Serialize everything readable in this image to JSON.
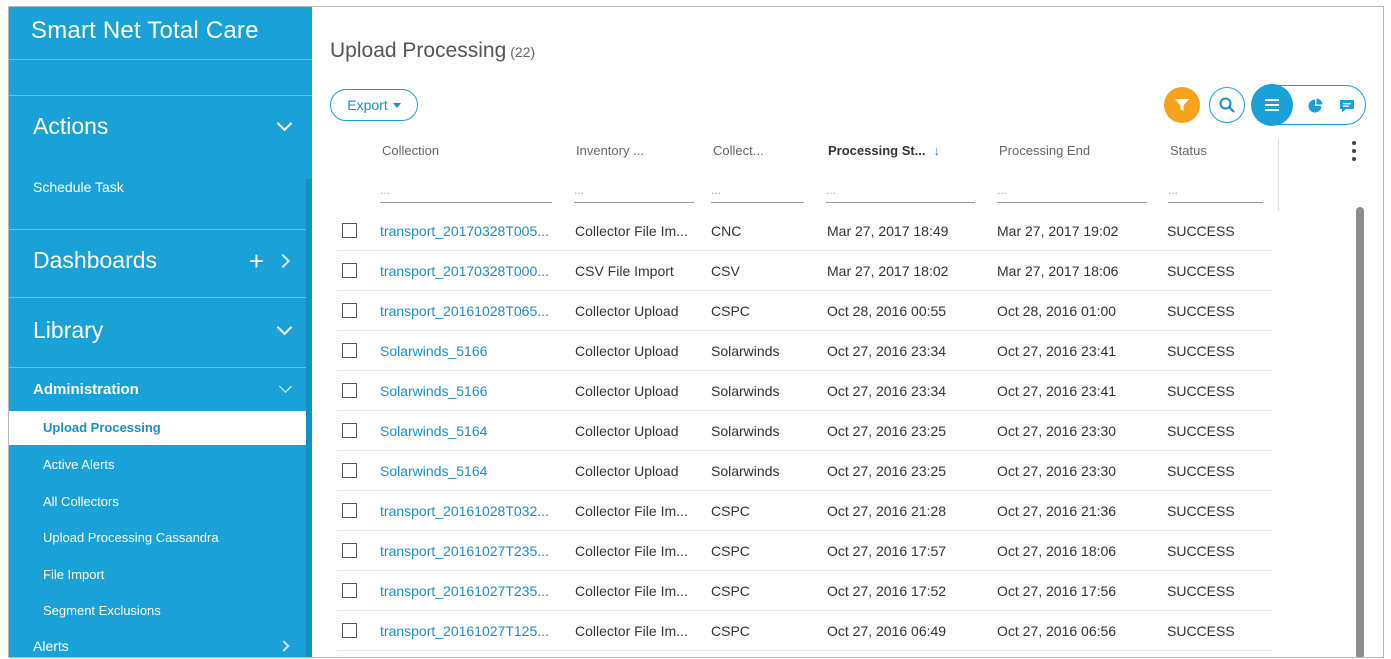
{
  "sidebar": {
    "brand": "Smart Net Total Care",
    "actions": "Actions",
    "schedule_task": "Schedule Task",
    "dashboards": "Dashboards",
    "library": "Library",
    "administration": "Administration",
    "admin_items": [
      "Upload Processing",
      "Active Alerts",
      "All Collectors",
      "Upload Processing Cassandra",
      "File Import",
      "Segment Exclusions"
    ],
    "alerts": "Alerts"
  },
  "page": {
    "title": "Upload Processing",
    "count": "(22)",
    "export_label": "Export"
  },
  "table": {
    "headers": [
      "Collection",
      "Inventory ...",
      "Collect...",
      "Processing St...",
      "Processing End",
      "Status"
    ],
    "sort_arrow": "↓",
    "filter_placeholder": "...",
    "rows": [
      [
        "transport_20170328T005...",
        "Collector File Im...",
        "CNC",
        "Mar 27, 2017 18:49",
        "Mar 27, 2017 19:02",
        "SUCCESS"
      ],
      [
        "transport_20170328T000...",
        "CSV File Import",
        "CSV",
        "Mar 27, 2017 18:02",
        "Mar 27, 2017 18:06",
        "SUCCESS"
      ],
      [
        "transport_20161028T065...",
        "Collector Upload",
        "CSPC",
        "Oct 28, 2016 00:55",
        "Oct 28, 2016 01:00",
        "SUCCESS"
      ],
      [
        "Solarwinds_5166",
        "Collector Upload",
        "Solarwinds",
        "Oct 27, 2016 23:34",
        "Oct 27, 2016 23:41",
        "SUCCESS"
      ],
      [
        "Solarwinds_5166",
        "Collector Upload",
        "Solarwinds",
        "Oct 27, 2016 23:34",
        "Oct 27, 2016 23:41",
        "SUCCESS"
      ],
      [
        "Solarwinds_5164",
        "Collector Upload",
        "Solarwinds",
        "Oct 27, 2016 23:25",
        "Oct 27, 2016 23:30",
        "SUCCESS"
      ],
      [
        "Solarwinds_5164",
        "Collector Upload",
        "Solarwinds",
        "Oct 27, 2016 23:25",
        "Oct 27, 2016 23:30",
        "SUCCESS"
      ],
      [
        "transport_20161028T032...",
        "Collector File Im...",
        "CSPC",
        "Oct 27, 2016 21:28",
        "Oct 27, 2016 21:36",
        "SUCCESS"
      ],
      [
        "transport_20161027T235...",
        "Collector File Im...",
        "CSPC",
        "Oct 27, 2016 17:57",
        "Oct 27, 2016 18:06",
        "SUCCESS"
      ],
      [
        "transport_20161027T235...",
        "Collector File Im...",
        "CSPC",
        "Oct 27, 2016 17:52",
        "Oct 27, 2016 17:56",
        "SUCCESS"
      ],
      [
        "transport_20161027T125...",
        "Collector File Im...",
        "CSPC",
        "Oct 27, 2016 06:49",
        "Oct 27, 2016 06:56",
        "SUCCESS"
      ]
    ]
  },
  "colors": {
    "sidebar": "#1aa1d8",
    "link": "#1a8fc7",
    "filter": "#f6a21c"
  },
  "icons": [
    "chevron-down-icon",
    "plus-icon",
    "chevron-right-icon",
    "filter-icon",
    "search-icon",
    "list-view-icon",
    "pie-chart-icon",
    "chat-icon",
    "more-vertical-icon"
  ]
}
